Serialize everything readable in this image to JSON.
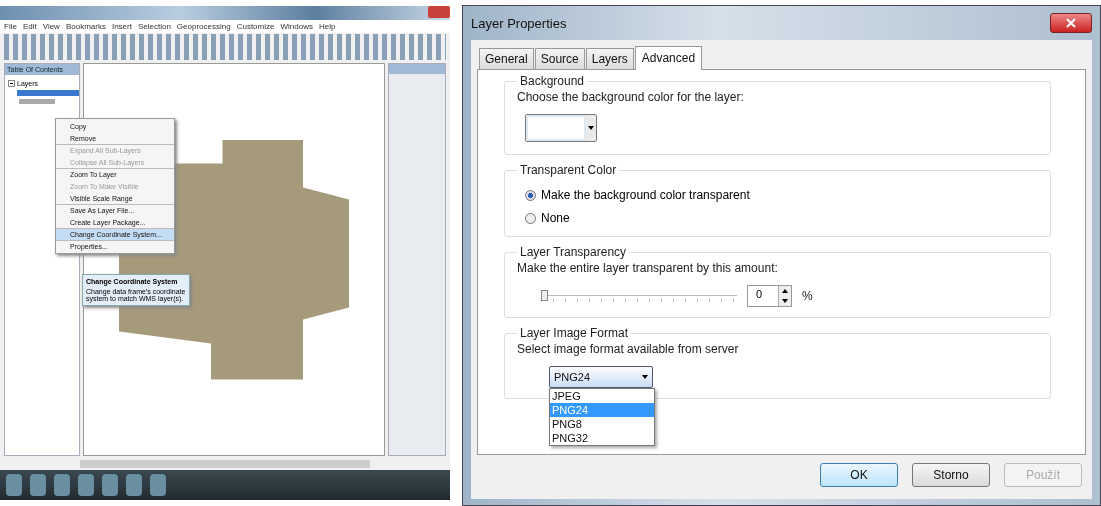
{
  "left_screenshot": {
    "menu_bar": [
      "File",
      "Edit",
      "View",
      "Bookmarks",
      "Insert",
      "Selection",
      "Geoprocessing",
      "Customize",
      "Windows",
      "Help"
    ],
    "toc": {
      "title": "Table Of Contents",
      "root": {
        "label": "Layers"
      }
    },
    "context_menu": [
      {
        "label": "Copy",
        "disabled": false,
        "selected": false,
        "separator_before": false
      },
      {
        "label": "Remove",
        "disabled": false,
        "selected": false,
        "separator_before": false
      },
      {
        "label": "Expand All Sub-Layers",
        "disabled": true,
        "selected": false,
        "separator_before": true
      },
      {
        "label": "Collapse All Sub-Layers",
        "disabled": true,
        "selected": false,
        "separator_before": false
      },
      {
        "label": "Zoom To Layer",
        "disabled": false,
        "selected": false,
        "separator_before": true
      },
      {
        "label": "Zoom To Make Visible",
        "disabled": true,
        "selected": false,
        "separator_before": false
      },
      {
        "label": "Visible Scale Range",
        "disabled": false,
        "selected": false,
        "separator_before": false
      },
      {
        "label": "Save As Layer File...",
        "disabled": false,
        "selected": false,
        "separator_before": true
      },
      {
        "label": "Create Layer Package...",
        "disabled": false,
        "selected": false,
        "separator_before": false
      },
      {
        "label": "Change Coordinate System...",
        "disabled": false,
        "selected": true,
        "separator_before": true
      },
      {
        "label": "Properties...",
        "disabled": false,
        "selected": false,
        "separator_before": true
      }
    ],
    "tooltip": {
      "title": "Change Coordinate System",
      "text": "Change data frame's coordinate system to match WMS layer(s)."
    }
  },
  "dialog": {
    "title": "Layer Properties",
    "tabs": [
      {
        "label": "General",
        "selected": false
      },
      {
        "label": "Source",
        "selected": false
      },
      {
        "label": "Layers",
        "selected": false
      },
      {
        "label": "Advanced",
        "selected": true
      }
    ],
    "background": {
      "legend": "Background",
      "label": "Choose the background color for the layer:"
    },
    "transparent_color": {
      "legend": "Transparent Color",
      "options": [
        {
          "label": "Make the background color transparent",
          "selected": true
        },
        {
          "label": "None",
          "selected": false
        }
      ]
    },
    "layer_transparency": {
      "legend": "Layer Transparency",
      "label": "Make the entire layer transparent by this amount:",
      "level": 0,
      "value": "0",
      "unit": "%"
    },
    "image_format": {
      "legend": "Layer Image Format",
      "label": "Select image format available from server",
      "value": "PNG24",
      "expanded": true,
      "options": [
        {
          "label": "JPEG",
          "selected": false
        },
        {
          "label": "PNG24",
          "selected": true
        },
        {
          "label": "PNG8",
          "selected": false
        },
        {
          "label": "PNG32",
          "selected": false
        }
      ]
    },
    "buttons": [
      {
        "label": "OK",
        "disabled": false,
        "default": true
      },
      {
        "label": "Storno",
        "disabled": false,
        "default": false
      },
      {
        "label": "Použít",
        "disabled": true,
        "default": false
      }
    ]
  }
}
